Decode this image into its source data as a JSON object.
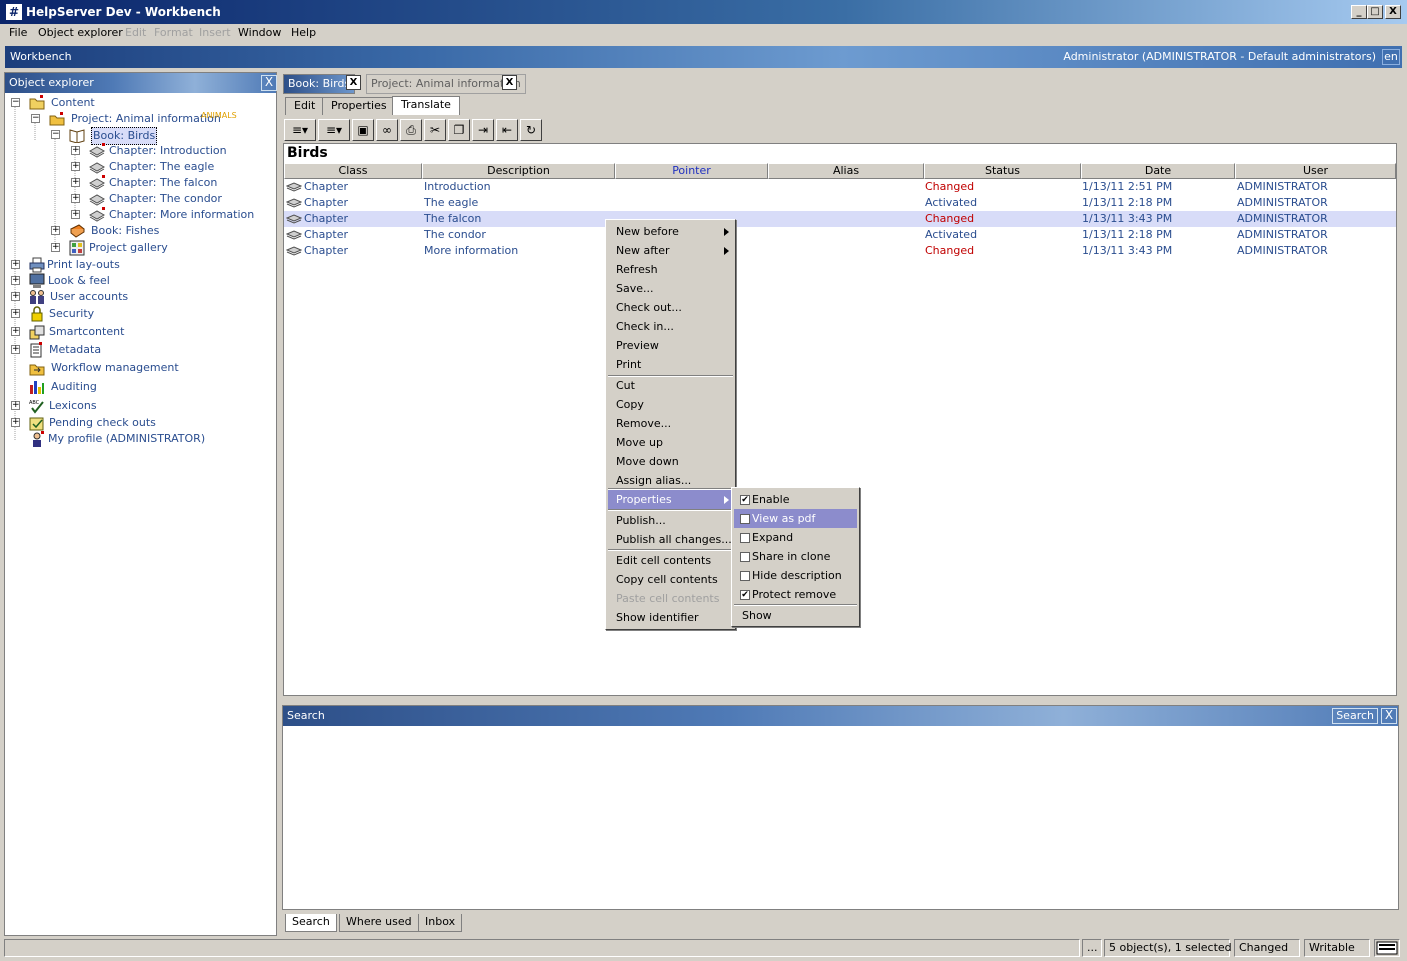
{
  "window": {
    "title": "HelpServer Dev - Workbench",
    "logo": "#",
    "min": "_",
    "max": "□",
    "close": "X"
  },
  "menubar": [
    {
      "label": "File",
      "enabled": true
    },
    {
      "label": "Object explorer",
      "enabled": true
    },
    {
      "label": "Edit",
      "enabled": false
    },
    {
      "label": "Format",
      "enabled": false
    },
    {
      "label": "Insert",
      "enabled": false
    },
    {
      "label": "Window",
      "enabled": true
    },
    {
      "label": "Help",
      "enabled": true
    }
  ],
  "workbench": {
    "label": "Workbench",
    "user": "Administrator (ADMINISTRATOR - Default administrators)",
    "lang": "en"
  },
  "explorer": {
    "title": "Object explorer",
    "close": "X",
    "nodes": [
      {
        "label": "Content",
        "icon": "folder-icon"
      },
      {
        "label": "Project: Animal information",
        "tag": "ANIMALS",
        "icon": "project-icon"
      },
      {
        "label": "Book: Birds",
        "icon": "book-open-icon"
      },
      {
        "label": "Chapter: Introduction",
        "icon": "chapter-icon"
      },
      {
        "label": "Chapter: The eagle",
        "icon": "chapter-icon"
      },
      {
        "label": "Chapter: The falcon",
        "icon": "chapter-icon"
      },
      {
        "label": "Chapter: The condor",
        "icon": "chapter-icon"
      },
      {
        "label": "Chapter: More information",
        "icon": "chapter-icon"
      },
      {
        "label": "Book: Fishes",
        "icon": "book-icon"
      },
      {
        "label": "Project gallery",
        "icon": "gallery-icon"
      },
      {
        "label": "Print lay-outs",
        "icon": "printer-icon"
      },
      {
        "label": "Look & feel",
        "icon": "monitor-icon"
      },
      {
        "label": "User accounts",
        "icon": "users-icon"
      },
      {
        "label": "Security",
        "icon": "lock-icon"
      },
      {
        "label": "Smartcontent",
        "icon": "smartcontent-icon"
      },
      {
        "label": "Metadata",
        "icon": "metadata-icon"
      },
      {
        "label": "Workflow management",
        "icon": "workflow-icon"
      },
      {
        "label": "Auditing",
        "icon": "chart-icon"
      },
      {
        "label": "Lexicons",
        "icon": "spellcheck-icon"
      },
      {
        "label": "Pending check outs",
        "icon": "checkout-icon"
      },
      {
        "label": "My profile (ADMINISTRATOR)",
        "icon": "profile-icon"
      }
    ]
  },
  "doctabs": [
    {
      "label": "Book: Birds",
      "close": "X"
    },
    {
      "label": "Project: Animal information",
      "close": "X"
    }
  ],
  "subtabs": [
    "Edit",
    "Properties",
    "Translate"
  ],
  "toolbar": [
    {
      "name": "new-dropdown-button",
      "glyph": "≡▾"
    },
    {
      "name": "insert-dropdown-button",
      "glyph": "≡▾"
    },
    {
      "name": "save-button",
      "glyph": "▣"
    },
    {
      "name": "preview-button",
      "glyph": "∞"
    },
    {
      "name": "print-button",
      "glyph": "⎙"
    },
    {
      "name": "cut-button",
      "glyph": "✂"
    },
    {
      "name": "copy-button",
      "glyph": "❐"
    },
    {
      "name": "indent-button",
      "glyph": "⇥"
    },
    {
      "name": "outdent-button",
      "glyph": "⇤"
    },
    {
      "name": "refresh-button",
      "glyph": "↻"
    }
  ],
  "table": {
    "heading": "Birds",
    "columns": [
      "Class",
      "Description",
      "Pointer",
      "Alias",
      "Status",
      "Date",
      "User"
    ],
    "rows": [
      {
        "class": "Chapter",
        "description": "Introduction",
        "pointer": "",
        "alias": "",
        "status": "Changed",
        "date": "1/13/11 2:51 PM",
        "user": "ADMINISTRATOR"
      },
      {
        "class": "Chapter",
        "description": "The eagle",
        "pointer": "",
        "alias": "",
        "status": "Activated",
        "date": "1/13/11 2:18 PM",
        "user": "ADMINISTRATOR"
      },
      {
        "class": "Chapter",
        "description": "The falcon",
        "pointer": "",
        "alias": "",
        "status": "Changed",
        "date": "1/13/11 3:43 PM",
        "user": "ADMINISTRATOR"
      },
      {
        "class": "Chapter",
        "description": "The condor",
        "pointer": "",
        "alias": "",
        "status": "Activated",
        "date": "1/13/11 2:18 PM",
        "user": "ADMINISTRATOR"
      },
      {
        "class": "Chapter",
        "description": "More information",
        "pointer": "",
        "alias": "",
        "status": "Changed",
        "date": "1/13/11 3:43 PM",
        "user": "ADMINISTRATOR"
      }
    ]
  },
  "context_menu": {
    "groups": [
      [
        "New before",
        "New after",
        "Refresh",
        "Save...",
        "Check out...",
        "Check in...",
        "Preview",
        "Print"
      ],
      [
        "Cut",
        "Copy",
        "Remove...",
        "Move up",
        "Move down",
        "Assign alias..."
      ],
      [
        "Properties"
      ],
      [
        "Publish...",
        "Publish all changes..."
      ],
      [
        "Edit cell contents",
        "Copy cell contents",
        "Paste cell contents",
        "Show identifier"
      ]
    ]
  },
  "submenu": {
    "items": [
      {
        "label": "Enable",
        "checked": true
      },
      {
        "label": "View as pdf",
        "checked": false
      },
      {
        "label": "Expand",
        "checked": false
      },
      {
        "label": "Share in clone",
        "checked": false
      },
      {
        "label": "Hide description",
        "checked": false
      },
      {
        "label": "Protect remove",
        "checked": true
      }
    ],
    "extra": "Show",
    "check_mark": "✔"
  },
  "search": {
    "title": "Search",
    "button": "Search",
    "close": "X"
  },
  "bottomtabs": [
    "Search",
    "Where used",
    "Inbox"
  ],
  "status": {
    "dots": "...",
    "objects": "5 object(s), 1 selected",
    "state": "Changed",
    "mode": "Writable"
  }
}
